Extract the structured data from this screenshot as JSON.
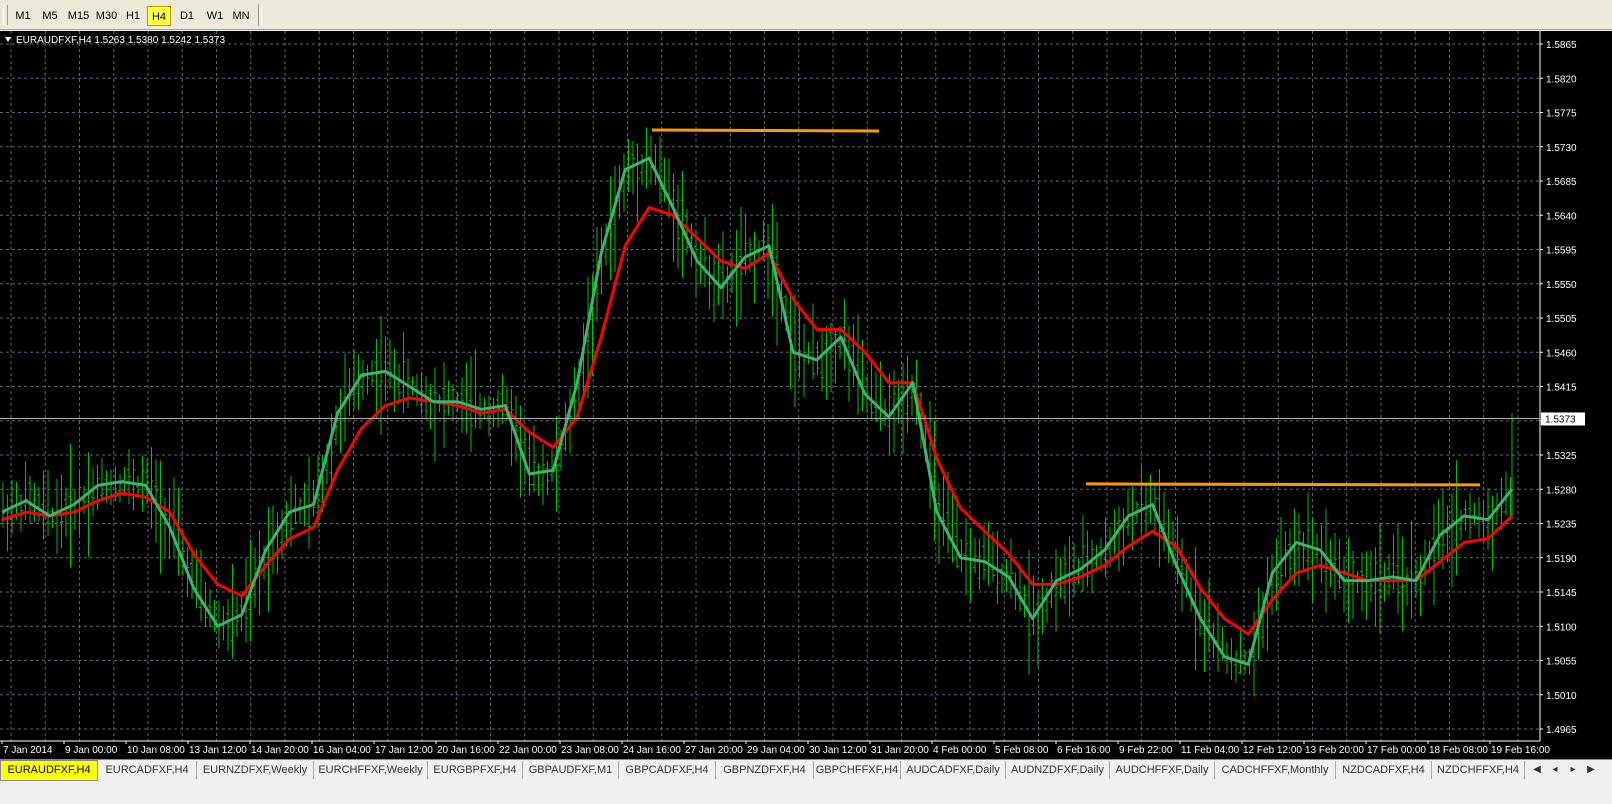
{
  "toolbar": {
    "timeframes": [
      {
        "label": "M1",
        "active": false
      },
      {
        "label": "M5",
        "active": false
      },
      {
        "label": "M15",
        "active": false
      },
      {
        "label": "M30",
        "active": false
      },
      {
        "label": "H1",
        "active": false
      },
      {
        "label": "H4",
        "active": true
      },
      {
        "label": "D1",
        "active": false
      },
      {
        "label": "W1",
        "active": false
      },
      {
        "label": "MN",
        "active": false
      }
    ]
  },
  "chart": {
    "header": "EURAUDFXF,H4  1.5263 1.5380 1.5242 1.5373",
    "current_price": "1.5373",
    "colors": {
      "background": "#000000",
      "grid": "#5a6478",
      "bars": "#00c000",
      "fast_ma": "#3cb371",
      "slow_ma": "#ff0000",
      "levels": "#ff9900",
      "axis_text": "#ffffff"
    }
  },
  "chart_data": {
    "type": "line",
    "symbol": "EURAUDFXF",
    "timeframe": "H4",
    "ohlc_last": {
      "open": 1.5263,
      "high": 1.538,
      "low": 1.5242,
      "close": 1.5373
    },
    "y_ticks": [
      "1.5865",
      "1.5820",
      "1.5775",
      "1.5730",
      "1.5685",
      "1.5640",
      "1.5595",
      "1.5550",
      "1.5505",
      "1.5460",
      "1.5415",
      "1.5370",
      "1.5325",
      "1.5280",
      "1.5235",
      "1.5190",
      "1.5145",
      "1.5100",
      "1.5055",
      "1.5010",
      "1.4965"
    ],
    "ylim": [
      1.4965,
      1.5865
    ],
    "x_ticks": [
      "7 Jan 2014",
      "9 Jan 00:00",
      "10 Jan 08:00",
      "13 Jan 12:00",
      "14 Jan 20:00",
      "16 Jan 04:00",
      "17 Jan 12:00",
      "20 Jan 16:00",
      "22 Jan 00:00",
      "23 Jan 08:00",
      "24 Jan 16:00",
      "27 Jan 20:00",
      "29 Jan 04:00",
      "30 Jan 12:00",
      "31 Jan 20:00",
      "4 Feb 00:00",
      "5 Feb 08:00",
      "6 Feb 16:00",
      "9 Feb 22:00",
      "11 Feb 04:00",
      "12 Feb 12:00",
      "13 Feb 20:00",
      "17 Feb 00:00",
      "18 Feb 08:00",
      "19 Feb 16:00"
    ],
    "series": [
      {
        "color": "#3cb371",
        "values": [
          1.525,
          1.5265,
          1.5245,
          1.526,
          1.5285,
          1.529,
          1.5285,
          1.523,
          1.515,
          1.51,
          1.5115,
          1.52,
          1.525,
          1.526,
          1.538,
          1.543,
          1.5435,
          1.5415,
          1.5395,
          1.5395,
          1.5385,
          1.539,
          1.53,
          1.5305,
          1.542,
          1.559,
          1.57,
          1.5715,
          1.565,
          1.558,
          1.5545,
          1.5585,
          1.56,
          1.546,
          1.545,
          1.548,
          1.5405,
          1.5375,
          1.542,
          1.525,
          1.519,
          1.5185,
          1.5165,
          1.511,
          1.516,
          1.5175,
          1.52,
          1.5245,
          1.526,
          1.518,
          1.511,
          1.506,
          1.505,
          1.517,
          1.521,
          1.52,
          1.516,
          1.516,
          1.5165,
          1.516,
          1.522,
          1.5245,
          1.524,
          1.528
        ]
      },
      {
        "color": "#ff0000",
        "values": [
          1.524,
          1.525,
          1.5245,
          1.525,
          1.5265,
          1.5275,
          1.527,
          1.525,
          1.5195,
          1.5155,
          1.514,
          1.518,
          1.5215,
          1.523,
          1.5305,
          1.536,
          1.539,
          1.54,
          1.5395,
          1.539,
          1.538,
          1.5385,
          1.5355,
          1.5335,
          1.5375,
          1.548,
          1.56,
          1.565,
          1.564,
          1.561,
          1.558,
          1.557,
          1.559,
          1.553,
          1.549,
          1.549,
          1.546,
          1.542,
          1.542,
          1.532,
          1.5255,
          1.5225,
          1.5195,
          1.5155,
          1.5155,
          1.5165,
          1.518,
          1.5205,
          1.5225,
          1.5205,
          1.515,
          1.511,
          1.509,
          1.5135,
          1.517,
          1.518,
          1.517,
          1.516,
          1.516,
          1.516,
          1.5185,
          1.521,
          1.5215,
          1.5245
        ]
      }
    ],
    "levels": [
      {
        "price": 1.5752,
        "from_x": "24 Jan 16:00",
        "to_x": "27 Jan 20:00"
      },
      {
        "price": 1.5287,
        "from_x": "6 Feb 16:00",
        "to_x": "18 Feb 08:00"
      }
    ]
  },
  "tabs": {
    "items": [
      {
        "label": "EURAUDFXF,H4",
        "active": true
      },
      {
        "label": "EURCADFXF,H4",
        "active": false
      },
      {
        "label": "EURNZDFXF,Weekly",
        "active": false
      },
      {
        "label": "EURCHFFXF,Weekly",
        "active": false
      },
      {
        "label": "EURGBPFXF,H4",
        "active": false
      },
      {
        "label": "GBPAUDFXF,M1",
        "active": false
      },
      {
        "label": "GBPCADFXF,H4",
        "active": false
      },
      {
        "label": "GBPNZDFXF,H4",
        "active": false
      },
      {
        "label": "GBPCHFFXF,H4",
        "active": false
      },
      {
        "label": "AUDCADFXF,Daily",
        "active": false
      },
      {
        "label": "AUDNZDFXF,Daily",
        "active": false
      },
      {
        "label": "AUDCHFFXF,Daily",
        "active": false
      },
      {
        "label": "CADCHFFXF,Monthly",
        "active": false
      },
      {
        "label": "NZDCADFXF,H4",
        "active": false
      },
      {
        "label": "NZDCHFFXF,H4",
        "active": false
      }
    ]
  }
}
